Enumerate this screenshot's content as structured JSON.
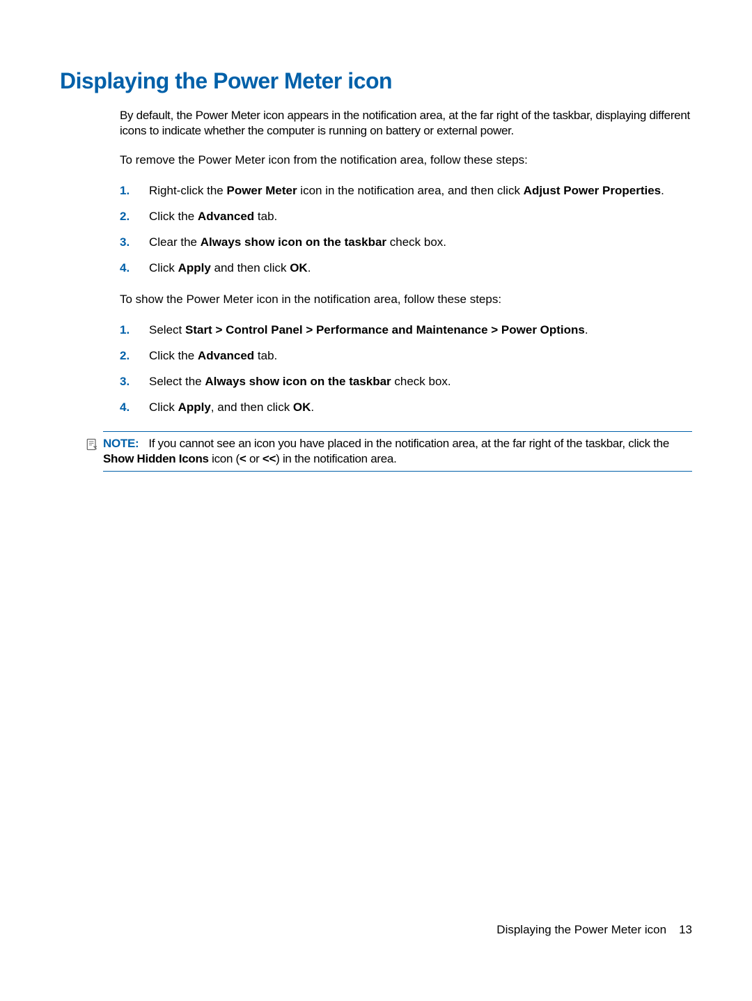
{
  "heading": "Displaying the Power Meter icon",
  "intro": "By default, the Power Meter icon appears in the notification area, at the far right of the taskbar, displaying different icons to indicate whether the computer is running on battery or external power.",
  "remove_lead": "To remove the Power Meter icon from the notification area, follow these steps:",
  "remove_steps": [
    {
      "pre": "Right-click the ",
      "b1": "Power Meter",
      "mid": " icon in the notification area, and then click ",
      "b2": "Adjust Power Properties",
      "post": "."
    },
    {
      "pre": "Click the ",
      "b1": "Advanced",
      "mid": " tab.",
      "b2": "",
      "post": ""
    },
    {
      "pre": "Clear the ",
      "b1": "Always show icon on the taskbar",
      "mid": " check box.",
      "b2": "",
      "post": ""
    },
    {
      "pre": "Click ",
      "b1": "Apply",
      "mid": " and then click ",
      "b2": "OK",
      "post": "."
    }
  ],
  "show_lead": "To show the Power Meter icon in the notification area, follow these steps:",
  "show_steps": [
    {
      "pre": "Select ",
      "b1": "Start > Control Panel > Performance and Maintenance > Power Options",
      "mid": ".",
      "b2": "",
      "post": ""
    },
    {
      "pre": "Click the ",
      "b1": "Advanced",
      "mid": " tab.",
      "b2": "",
      "post": ""
    },
    {
      "pre": "Select the ",
      "b1": "Always show icon on the taskbar",
      "mid": " check box.",
      "b2": "",
      "post": ""
    },
    {
      "pre": "Click ",
      "b1": "Apply",
      "mid": ", and then click ",
      "b2": "OK",
      "post": "."
    }
  ],
  "note_label": "NOTE:",
  "note": {
    "pre": "If you cannot see an icon you have placed in the notification area, at the far right of the taskbar, click the ",
    "b1": "Show Hidden Icons",
    "mid": " icon (",
    "b2": "<",
    "mid2": " or ",
    "b3": "<<",
    "post": ") in the notification area."
  },
  "footer_title": "Displaying the Power Meter icon",
  "footer_page": "13"
}
